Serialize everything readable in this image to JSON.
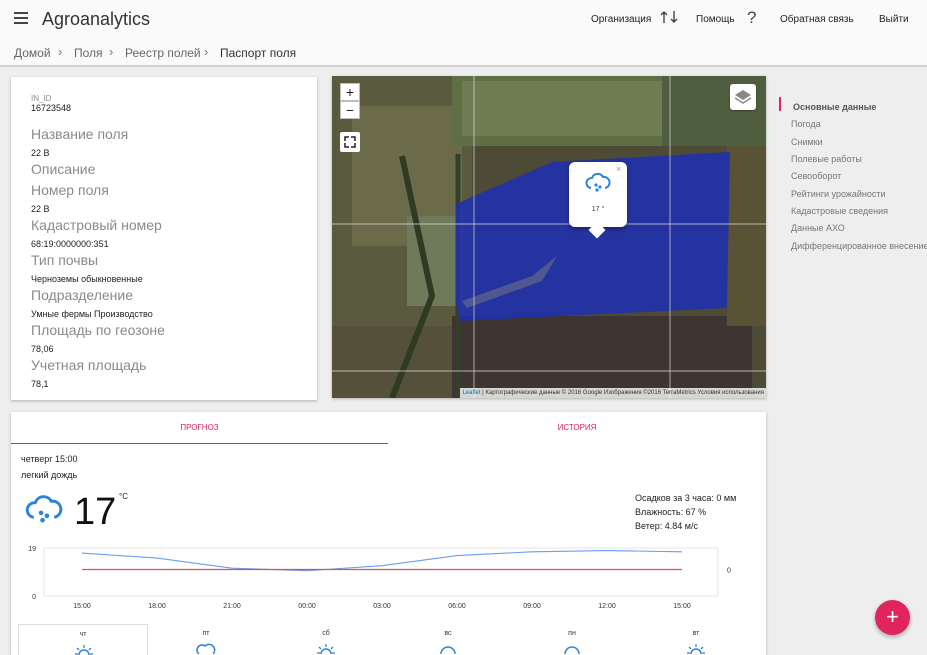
{
  "header": {
    "app_title": "Agroanalytics",
    "org_label": "Организация",
    "help_label": "Помощь",
    "feedback_label": "Обратная связь",
    "logout_label": "Выйти"
  },
  "breadcrumb": [
    "Домой",
    "Поля",
    "Реестр полей",
    "Паспорт поля"
  ],
  "field": {
    "id_label": "IN_ID",
    "id_value": "16723548",
    "rows": [
      {
        "label": "Название поля",
        "value": "22 В"
      },
      {
        "label": "Описание",
        "value": ""
      },
      {
        "label": "Номер поля",
        "value": "22 В"
      },
      {
        "label": "Кадастровый номер",
        "value": "68:19:0000000:351"
      },
      {
        "label": "Тип почвы",
        "value": "Черноземы обыкновенные"
      },
      {
        "label": "Подразделение",
        "value": "Умные фермы Производство"
      },
      {
        "label": "Площадь по геозоне",
        "value": "78,06"
      },
      {
        "label": "Учетная площадь",
        "value": "78,1"
      }
    ]
  },
  "map": {
    "zoom_in": "+",
    "zoom_out": "−",
    "popup_close": "×",
    "popup_temp": "17 °",
    "attribution_link": "Leaflet",
    "attribution_text": " | Картографические данные © 2016 Google Изображения ©2016 TerraMetrics Условия использования"
  },
  "side_nav": {
    "items": [
      "Основные данные",
      "Погода",
      "Снимки",
      "Полевые работы",
      "Севооборот",
      "Рейтинги урожайности",
      "Кадастровые сведения",
      "Данные АХО",
      "Дифференцированное внесение"
    ],
    "active_index": 0
  },
  "weather": {
    "tabs": [
      "Прогноз",
      "История"
    ],
    "datetime": "четверг 15:00",
    "condition": "легкий дождь",
    "temp": "17",
    "temp_unit": "°C",
    "precip": "Осадков за 3 часа: 0 мм",
    "humidity": "Влажность: 67 %",
    "wind": "Ветер: 4.84 м/с",
    "days": [
      "чт",
      "пт",
      "сб",
      "вс",
      "пн",
      "вт"
    ],
    "selected_day": 0
  },
  "chart_data": {
    "type": "line",
    "x": [
      "15:00",
      "18:00",
      "21:00",
      "00:00",
      "03:00",
      "06:00",
      "09:00",
      "12:00",
      "15:00"
    ],
    "series": [
      {
        "values": [
          17,
          15,
          11,
          10,
          12,
          16,
          17.5,
          18,
          17.5
        ],
        "color": "#6a9ef0"
      },
      {
        "values": [
          10.5,
          10.5,
          10.5,
          10.5,
          10.5,
          10.5,
          10.5,
          10.5,
          10.5
        ],
        "color": "#e05050"
      }
    ],
    "y_left_ticks": [
      0,
      19
    ],
    "y_right_ticks": [
      0
    ],
    "ylim": [
      0,
      19
    ]
  },
  "colors": {
    "accent": "#e0245e",
    "field_overlay": "#1f2fb3"
  },
  "fab_label": "+"
}
